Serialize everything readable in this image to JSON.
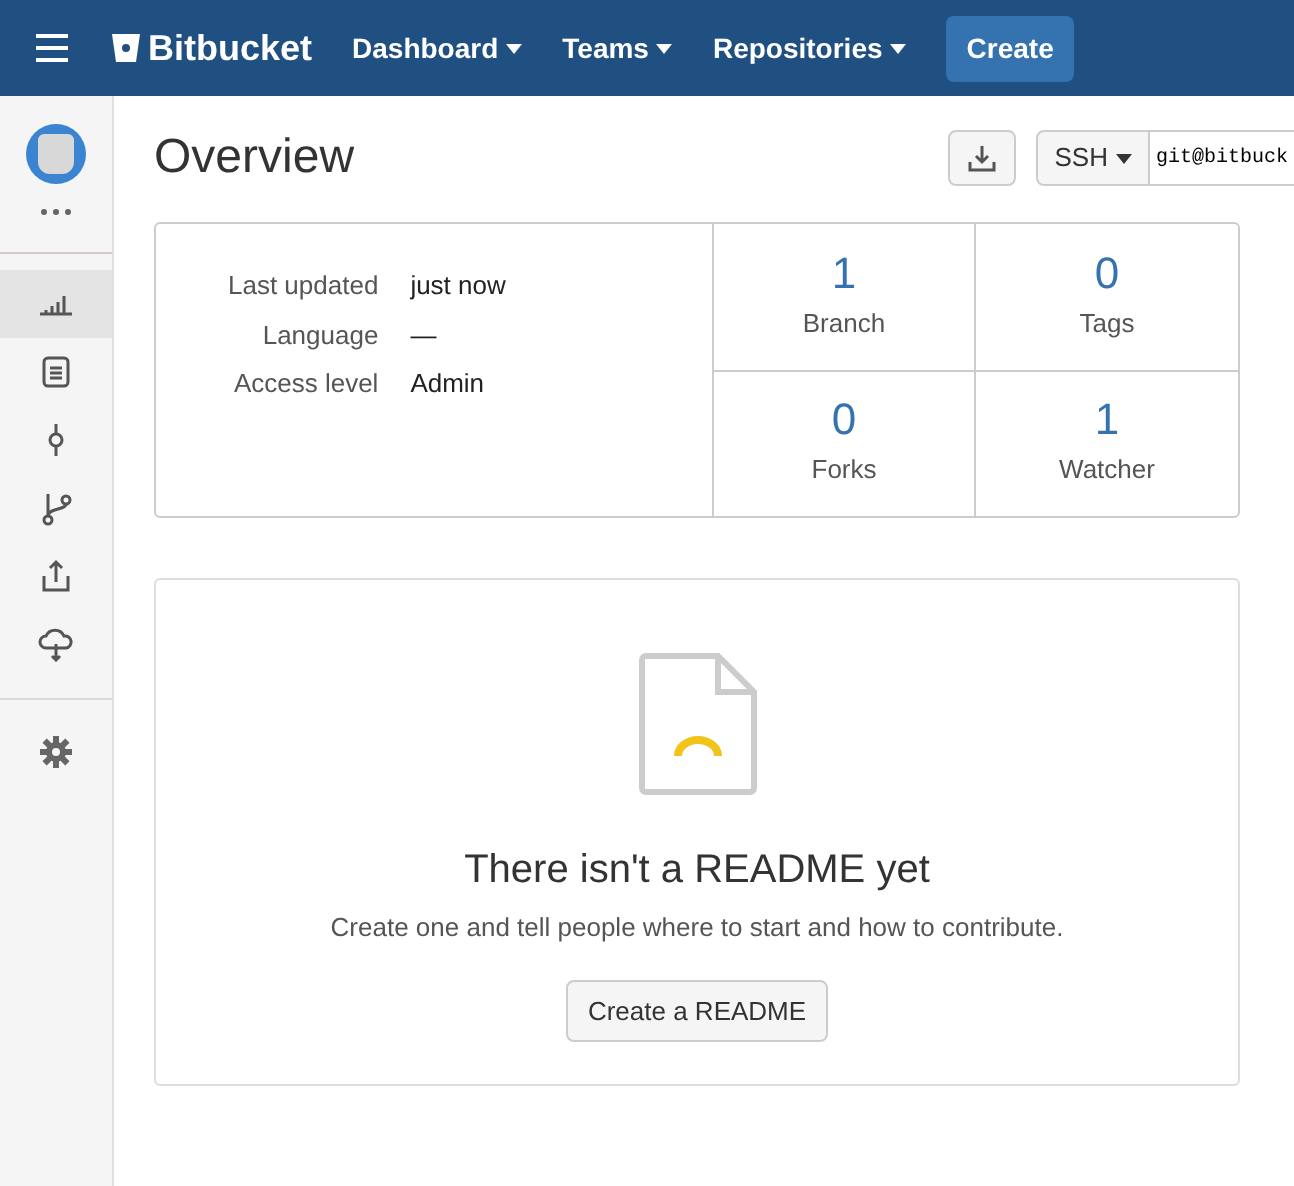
{
  "navbar": {
    "brand": "Bitbucket",
    "menus": [
      {
        "label": "Dashboard"
      },
      {
        "label": "Teams"
      },
      {
        "label": "Repositories"
      }
    ],
    "create": "Create"
  },
  "sidebar": {
    "items": [
      {
        "kind": "overview",
        "selected": true
      },
      {
        "kind": "source",
        "selected": false
      },
      {
        "kind": "commits",
        "selected": false
      },
      {
        "kind": "branches",
        "selected": false
      },
      {
        "kind": "pull",
        "selected": false
      },
      {
        "kind": "downloads",
        "selected": false
      }
    ]
  },
  "header": {
    "title": "Overview",
    "protocol": "SSH",
    "clone_url": "git@bitbuck"
  },
  "details": [
    {
      "label": "Last updated",
      "value": "just now"
    },
    {
      "label": "Language",
      "value": "—"
    },
    {
      "label": "Access level",
      "value": "Admin"
    }
  ],
  "stats": [
    {
      "count": "1",
      "label": "Branch"
    },
    {
      "count": "0",
      "label": "Tags"
    },
    {
      "count": "0",
      "label": "Forks"
    },
    {
      "count": "1",
      "label": "Watcher"
    }
  ],
  "readme": {
    "heading": "There isn't a README yet",
    "text": "Create one and tell people where to start and how to contribute.",
    "button": "Create a README"
  }
}
